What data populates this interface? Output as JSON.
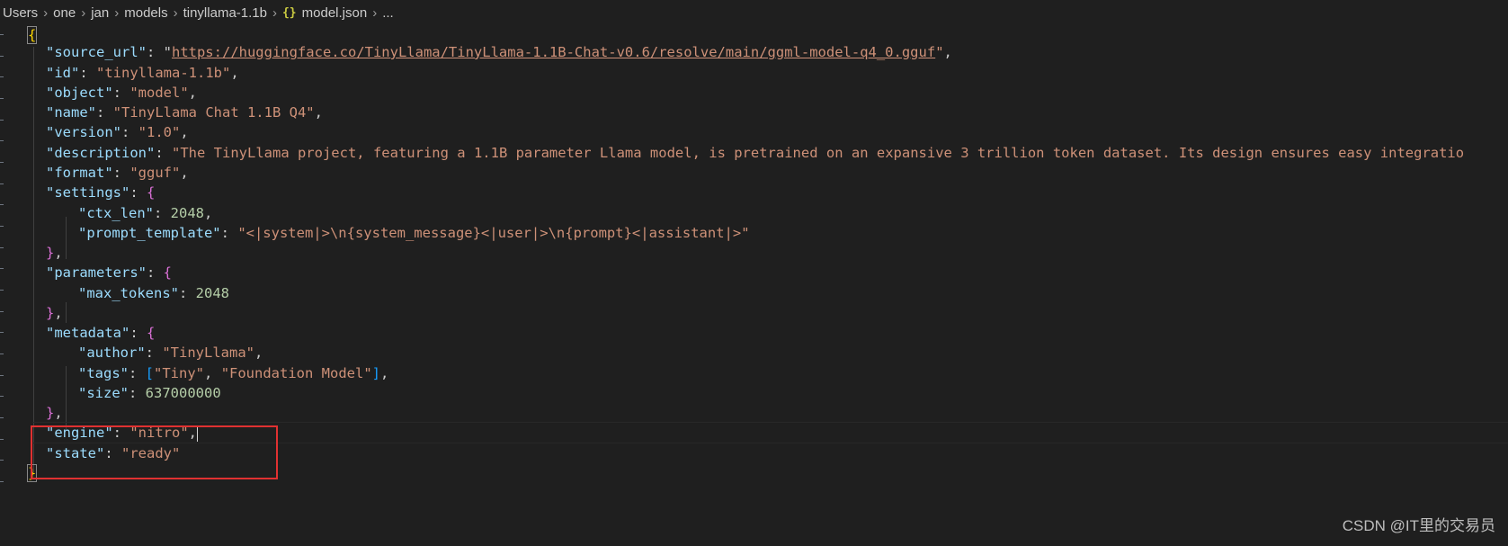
{
  "breadcrumb": {
    "items": [
      "Users",
      "one",
      "jan",
      "models",
      "tinyllama-1.1b"
    ],
    "file_icon": "{}",
    "file": "model.json",
    "tail": "..."
  },
  "code": {
    "open_brace": "{",
    "close_brace": "}",
    "source_url_key": "\"source_url\"",
    "source_url_value": "https://huggingface.co/TinyLlama/TinyLlama-1.1B-Chat-v0.6/resolve/main/ggml-model-q4_0.gguf",
    "id_key": "\"id\"",
    "id_value": "\"tinyllama-1.1b\"",
    "object_key": "\"object\"",
    "object_value": "\"model\"",
    "name_key": "\"name\"",
    "name_value": "\"TinyLlama Chat 1.1B Q4\"",
    "version_key": "\"version\"",
    "version_value": "\"1.0\"",
    "description_key": "\"description\"",
    "description_value": "\"The TinyLlama project, featuring a 1.1B parameter Llama model, is pretrained on an expansive 3 trillion token dataset. Its design ensures easy integratio",
    "format_key": "\"format\"",
    "format_value": "\"gguf\"",
    "settings_key": "\"settings\"",
    "ctx_len_key": "\"ctx_len\"",
    "ctx_len_value": "2048",
    "prompt_template_key": "\"prompt_template\"",
    "prompt_template_value": "\"<|system|>\\n{system_message}<|user|>\\n{prompt}<|assistant|>\"",
    "parameters_key": "\"parameters\"",
    "max_tokens_key": "\"max_tokens\"",
    "max_tokens_value": "2048",
    "metadata_key": "\"metadata\"",
    "author_key": "\"author\"",
    "author_value": "\"TinyLlama\"",
    "tags_key": "\"tags\"",
    "tag_1": "\"Tiny\"",
    "tag_2": "\"Foundation Model\"",
    "size_key": "\"size\"",
    "size_value": "637000000",
    "engine_key": "\"engine\"",
    "engine_value": "\"nitro\"",
    "state_key": "\"state\"",
    "state_value": "\"ready\""
  },
  "watermark": "CSDN @IT里的交易员",
  "colors": {
    "background": "#1f1f1f",
    "key": "#9cdcfe",
    "string": "#ce9178",
    "number": "#b5cea8",
    "bracket_level1": "#ffd700",
    "bracket_level2": "#da70d6",
    "bracket_level3": "#179fff",
    "highlight_box": "#e03131"
  }
}
